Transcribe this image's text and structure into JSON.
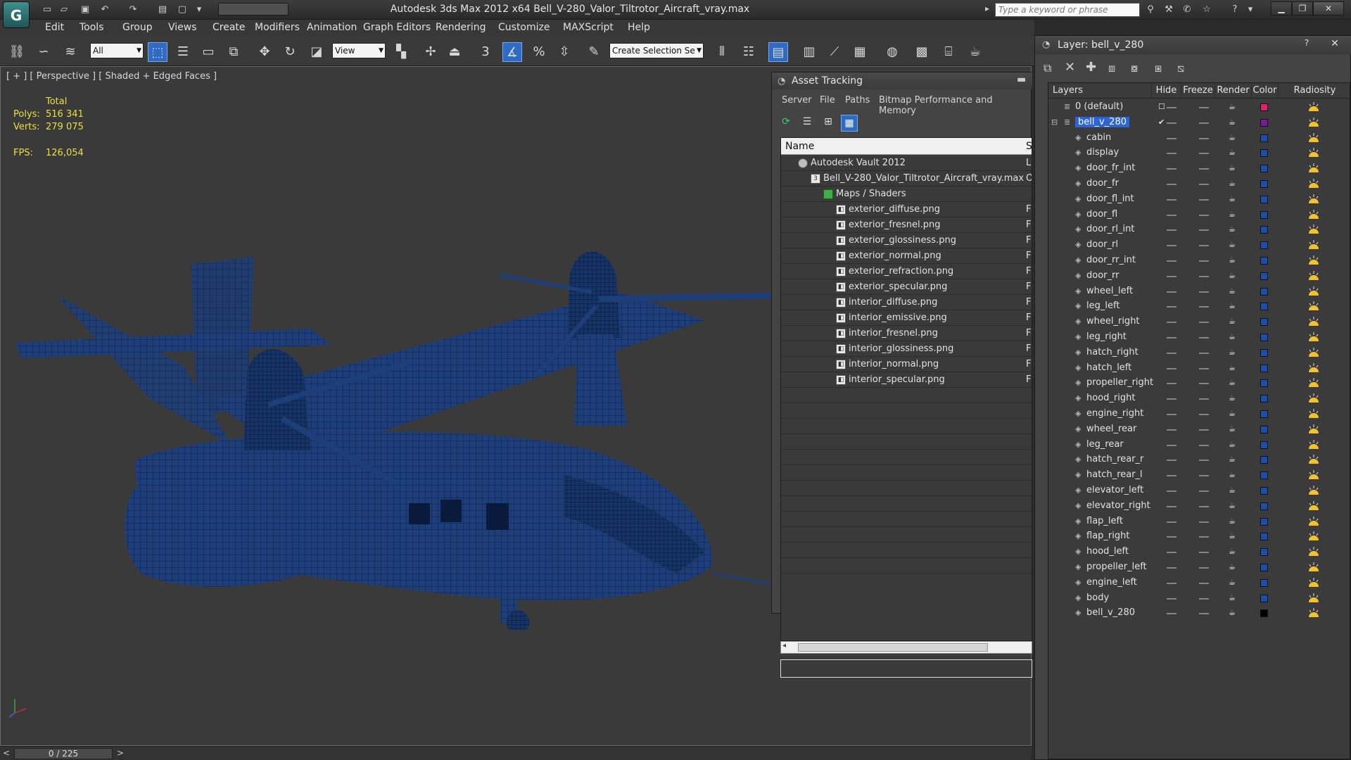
{
  "app": {
    "title": "Autodesk 3ds Max  2012 x64      Bell_V-280_Valor_Tiltrotor_Aircraft_vray.max",
    "logo_letter": "G",
    "search_placeholder": "Type a keyword or phrase",
    "workspace_label": ""
  },
  "menu": [
    "Edit",
    "Tools",
    "Group",
    "Views",
    "Create",
    "Modifiers",
    "Animation",
    "Graph Editors",
    "Rendering",
    "Customize",
    "MAXScript",
    "Help"
  ],
  "toolbar": {
    "selection_filter": "All",
    "ref_coord": "View",
    "named_selection_placeholder": "Create Selection Se",
    "snap_label": "3",
    "percent_label": "%"
  },
  "viewport": {
    "label": "[ + ] [ Perspective ] [ Shaded + Edged Faces ]",
    "stats": {
      "total_label": "Total",
      "polys_label": "Polys:",
      "polys_value": "516 341",
      "verts_label": "Verts:",
      "verts_value": "279 075",
      "fps_label": "FPS:",
      "fps_value": "126,054"
    },
    "wire_color": "#1a4fa0"
  },
  "timeline": {
    "frame_display": "0 / 225",
    "prev": "<",
    "next": ">"
  },
  "asset_tracking": {
    "title": "Asset Tracking",
    "menu": [
      "Server",
      "File",
      "Paths",
      "Bitmap Performance and Memory"
    ],
    "column_name": "Name",
    "column_status": "S",
    "rows": [
      {
        "name": "Autodesk Vault 2012",
        "indent": 0,
        "status": "L"
      },
      {
        "name": "Bell_V-280_Valor_Tiltrotor_Aircraft_vray.max",
        "indent": 1,
        "status": "O"
      },
      {
        "name": "Maps / Shaders",
        "indent": 2,
        "status": ""
      },
      {
        "name": "exterior_diffuse.png",
        "indent": 3,
        "status": "F"
      },
      {
        "name": "exterior_fresnel.png",
        "indent": 3,
        "status": "F"
      },
      {
        "name": "exterior_glossiness.png",
        "indent": 3,
        "status": "F"
      },
      {
        "name": "exterior_normal.png",
        "indent": 3,
        "status": "F"
      },
      {
        "name": "exterior_refraction.png",
        "indent": 3,
        "status": "F"
      },
      {
        "name": "exterior_specular.png",
        "indent": 3,
        "status": "F"
      },
      {
        "name": "interior_diffuse.png",
        "indent": 3,
        "status": "F"
      },
      {
        "name": "interior_emissive.png",
        "indent": 3,
        "status": "F"
      },
      {
        "name": "interior_fresnel.png",
        "indent": 3,
        "status": "F"
      },
      {
        "name": "interior_glossiness.png",
        "indent": 3,
        "status": "F"
      },
      {
        "name": "interior_normal.png",
        "indent": 3,
        "status": "F"
      },
      {
        "name": "interior_specular.png",
        "indent": 3,
        "status": "F"
      }
    ],
    "empty_rows": 12
  },
  "layers": {
    "title": "Layer: bell_v_280",
    "columns": [
      "Layers",
      "Hide",
      "Freeze",
      "Render",
      "Color",
      "Radiosity"
    ],
    "rows": [
      {
        "name": "0 (default)",
        "kind": "layer",
        "color": "#e0206a",
        "current": false
      },
      {
        "name": "bell_v_280",
        "kind": "layer",
        "color": "#7a1a9a",
        "current": true
      },
      {
        "name": "cabin",
        "kind": "object",
        "color": "#1b4fae"
      },
      {
        "name": "display",
        "kind": "object",
        "color": "#1b4fae"
      },
      {
        "name": "door_fr_int",
        "kind": "object",
        "color": "#1b4fae"
      },
      {
        "name": "door_fr",
        "kind": "object",
        "color": "#1b4fae"
      },
      {
        "name": "door_fl_int",
        "kind": "object",
        "color": "#1b4fae"
      },
      {
        "name": "door_fl",
        "kind": "object",
        "color": "#1b4fae"
      },
      {
        "name": "door_rl_int",
        "kind": "object",
        "color": "#1b4fae"
      },
      {
        "name": "door_rl",
        "kind": "object",
        "color": "#1b4fae"
      },
      {
        "name": "door_rr_int",
        "kind": "object",
        "color": "#1b4fae"
      },
      {
        "name": "door_rr",
        "kind": "object",
        "color": "#1b4fae"
      },
      {
        "name": "wheel_left",
        "kind": "object",
        "color": "#1b4fae"
      },
      {
        "name": "leg_left",
        "kind": "object",
        "color": "#1b4fae"
      },
      {
        "name": "wheel_right",
        "kind": "object",
        "color": "#1b4fae"
      },
      {
        "name": "leg_right",
        "kind": "object",
        "color": "#1b4fae"
      },
      {
        "name": "hatch_right",
        "kind": "object",
        "color": "#1b4fae"
      },
      {
        "name": "hatch_left",
        "kind": "object",
        "color": "#1b4fae"
      },
      {
        "name": "propeller_right",
        "kind": "object",
        "color": "#1b4fae"
      },
      {
        "name": "hood_right",
        "kind": "object",
        "color": "#1b4fae"
      },
      {
        "name": "engine_right",
        "kind": "object",
        "color": "#1b4fae"
      },
      {
        "name": "wheel_rear",
        "kind": "object",
        "color": "#1b4fae"
      },
      {
        "name": "leg_rear",
        "kind": "object",
        "color": "#1b4fae"
      },
      {
        "name": "hatch_rear_r",
        "kind": "object",
        "color": "#1b4fae"
      },
      {
        "name": "hatch_rear_l",
        "kind": "object",
        "color": "#1b4fae"
      },
      {
        "name": "elevator_left",
        "kind": "object",
        "color": "#1b4fae"
      },
      {
        "name": "elevator_right",
        "kind": "object",
        "color": "#1b4fae"
      },
      {
        "name": "flap_left",
        "kind": "object",
        "color": "#1b4fae"
      },
      {
        "name": "flap_right",
        "kind": "object",
        "color": "#1b4fae"
      },
      {
        "name": "hood_left",
        "kind": "object",
        "color": "#1b4fae"
      },
      {
        "name": "propeller_left",
        "kind": "object",
        "color": "#1b4fae"
      },
      {
        "name": "engine_left",
        "kind": "object",
        "color": "#1b4fae"
      },
      {
        "name": "body",
        "kind": "object",
        "color": "#1b4fae"
      },
      {
        "name": "bell_v_280",
        "kind": "object",
        "color": "#000000"
      }
    ]
  }
}
